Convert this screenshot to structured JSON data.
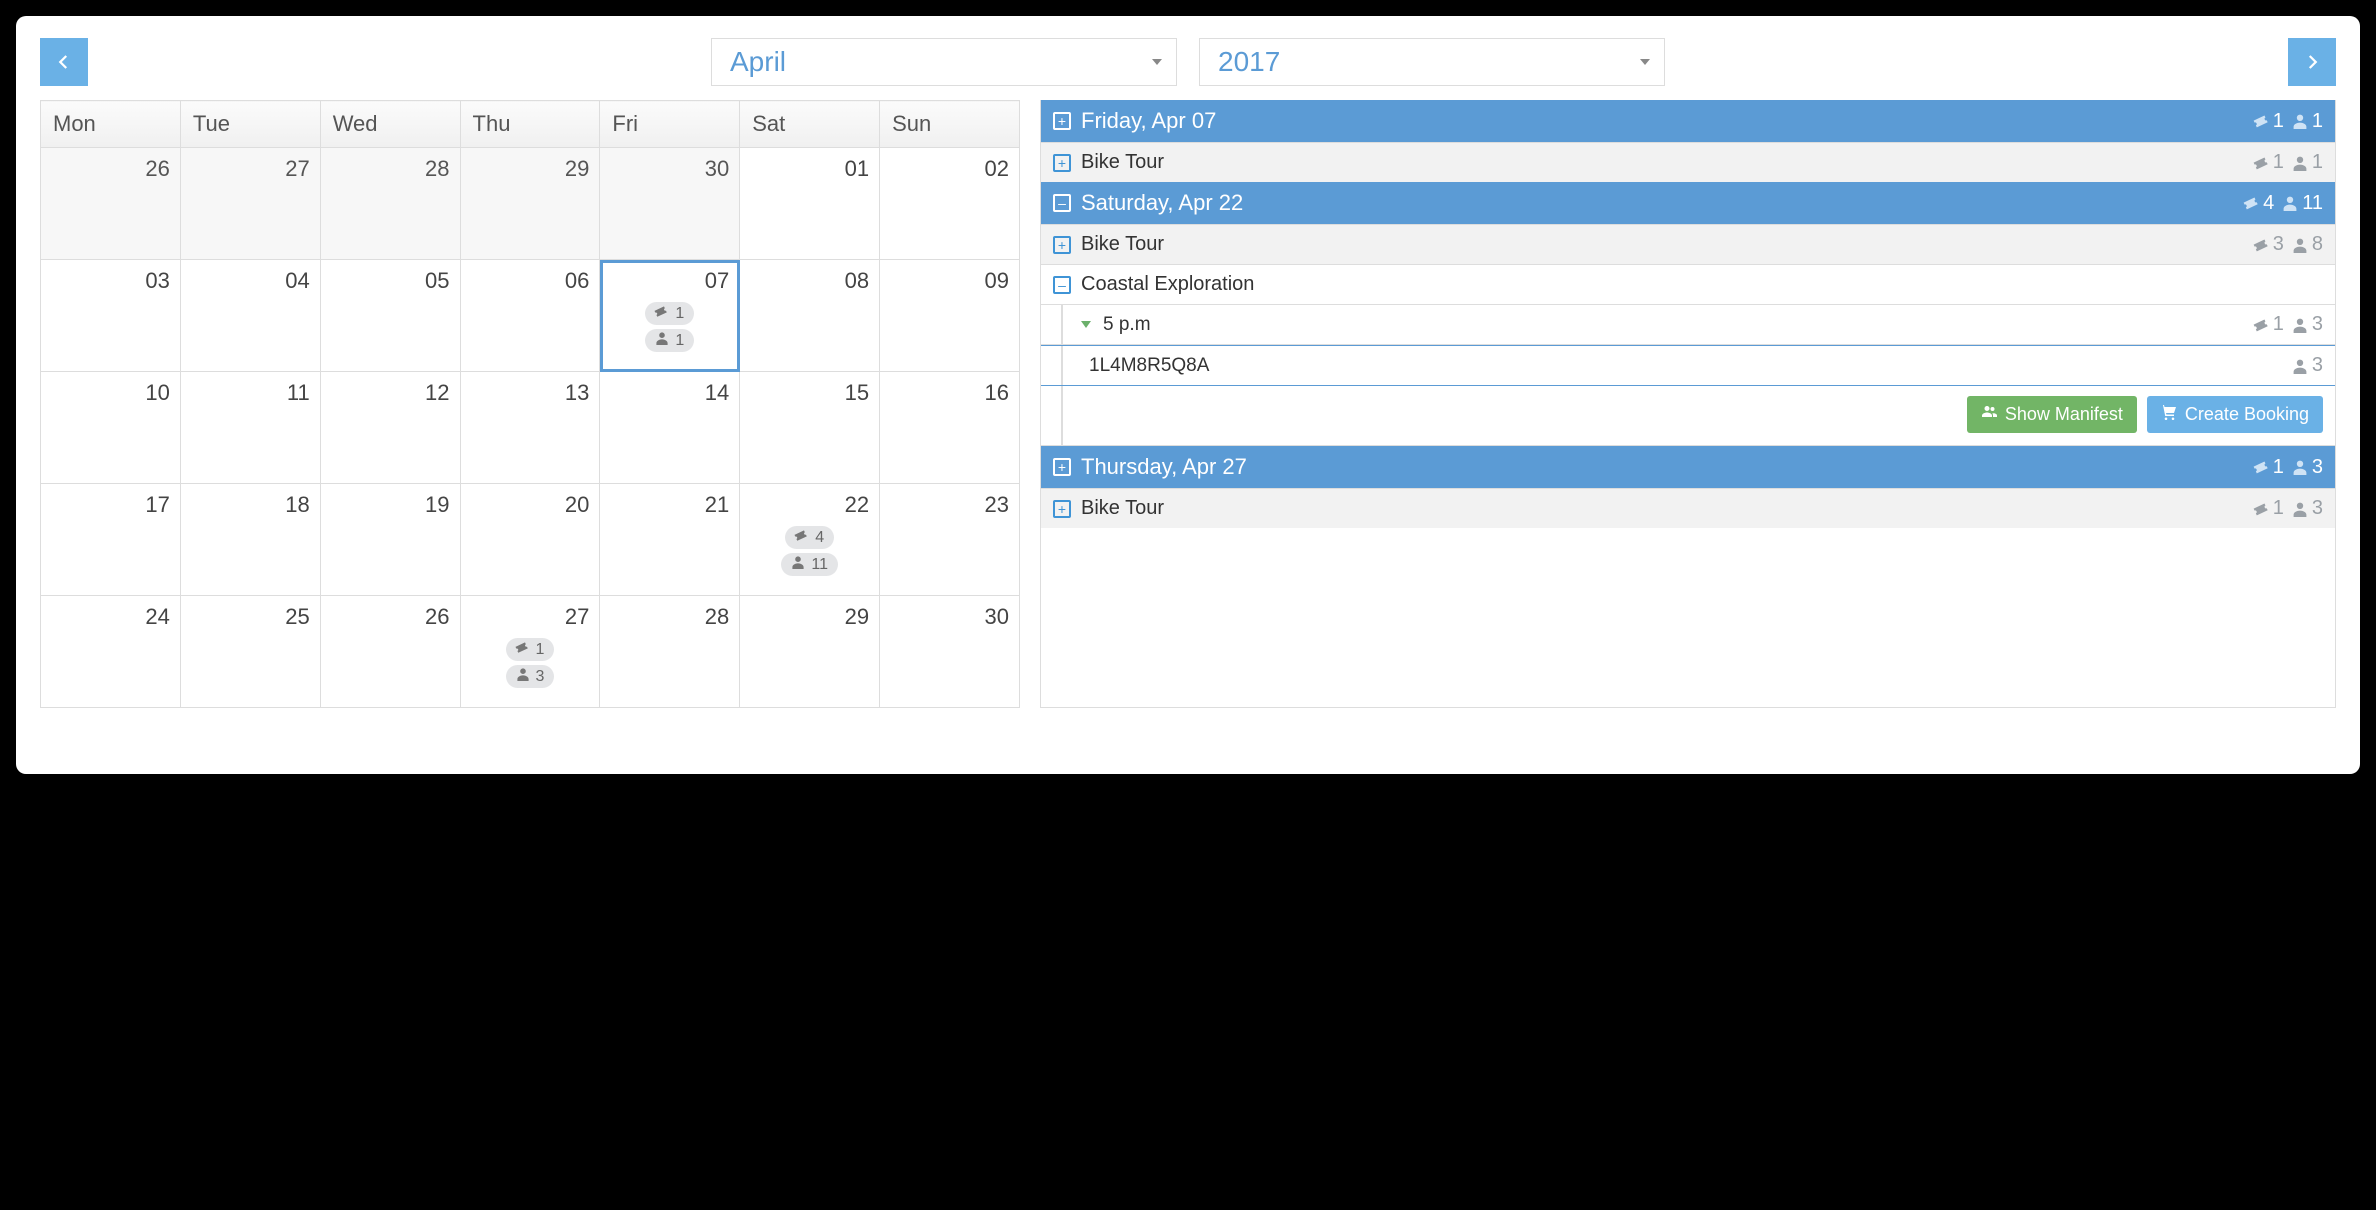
{
  "header": {
    "month": "April",
    "year": "2017"
  },
  "weekdays": [
    "Mon",
    "Tue",
    "Wed",
    "Thu",
    "Fri",
    "Sat",
    "Sun"
  ],
  "calendar": [
    [
      {
        "num": "26",
        "other": true
      },
      {
        "num": "27",
        "other": true
      },
      {
        "num": "28",
        "other": true
      },
      {
        "num": "29",
        "other": true
      },
      {
        "num": "30",
        "other": true
      },
      {
        "num": "01"
      },
      {
        "num": "02"
      }
    ],
    [
      {
        "num": "03"
      },
      {
        "num": "04"
      },
      {
        "num": "05"
      },
      {
        "num": "06"
      },
      {
        "num": "07",
        "selected": true,
        "tickets": "1",
        "people": "1"
      },
      {
        "num": "08"
      },
      {
        "num": "09"
      }
    ],
    [
      {
        "num": "10"
      },
      {
        "num": "11"
      },
      {
        "num": "12"
      },
      {
        "num": "13"
      },
      {
        "num": "14"
      },
      {
        "num": "15"
      },
      {
        "num": "16"
      }
    ],
    [
      {
        "num": "17"
      },
      {
        "num": "18"
      },
      {
        "num": "19"
      },
      {
        "num": "20"
      },
      {
        "num": "21"
      },
      {
        "num": "22",
        "tickets": "4",
        "people": "11"
      },
      {
        "num": "23"
      }
    ],
    [
      {
        "num": "24"
      },
      {
        "num": "25"
      },
      {
        "num": "26"
      },
      {
        "num": "27",
        "tickets": "1",
        "people": "3"
      },
      {
        "num": "28"
      },
      {
        "num": "29"
      },
      {
        "num": "30"
      }
    ]
  ],
  "side": {
    "days": [
      {
        "title": "Friday, Apr 07",
        "expanded": false,
        "tickets": "1",
        "people": "1",
        "activities": [
          {
            "name": "Bike Tour",
            "expanded": false,
            "tickets": "1",
            "people": "1",
            "bg": "gray"
          }
        ]
      },
      {
        "title": "Saturday, Apr 22",
        "expanded": true,
        "tickets": "4",
        "people": "11",
        "activities": [
          {
            "name": "Bike Tour",
            "expanded": false,
            "tickets": "3",
            "people": "8",
            "bg": "gray"
          },
          {
            "name": "Coastal Exploration",
            "expanded": true,
            "bg": "white",
            "times": [
              {
                "label": "5 p.m",
                "tickets": "1",
                "people": "3",
                "bookings": [
                  {
                    "code": "1L4M8R5Q8A",
                    "people": "3"
                  }
                ],
                "actions": {
                  "manifest": "Show Manifest",
                  "create": "Create Booking"
                }
              }
            ]
          }
        ]
      },
      {
        "title": "Thursday, Apr 27",
        "expanded": false,
        "tickets": "1",
        "people": "3",
        "activities": [
          {
            "name": "Bike Tour",
            "expanded": false,
            "tickets": "1",
            "people": "3",
            "bg": "gray"
          }
        ]
      }
    ]
  }
}
